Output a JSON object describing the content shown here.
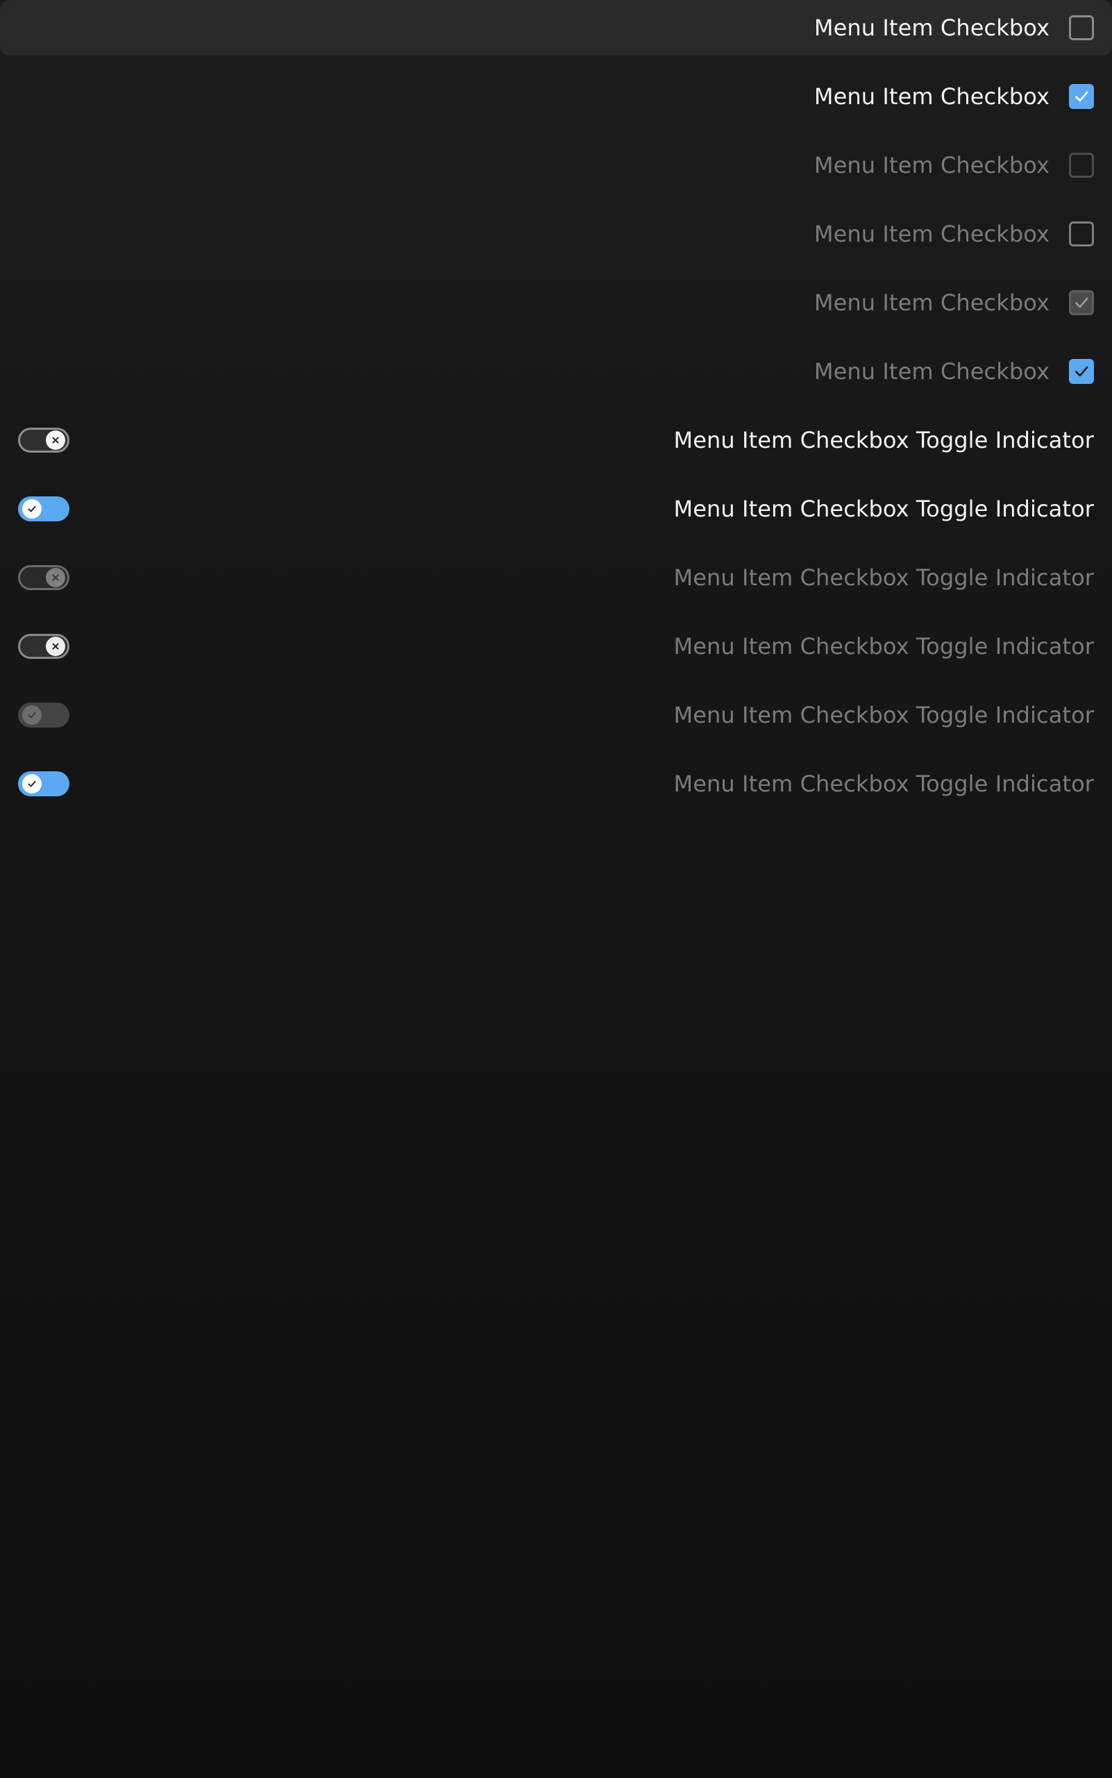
{
  "menu": {
    "checkbox_items": [
      {
        "label": "Menu Item Checkbox",
        "checked": false,
        "state": "highlighted"
      },
      {
        "label": "Menu Item Checkbox",
        "checked": true,
        "state": "normal"
      },
      {
        "label": "Menu Item Checkbox",
        "checked": false,
        "state": "disabled"
      },
      {
        "label": "Menu Item Checkbox",
        "checked": false,
        "state": "inactive"
      },
      {
        "label": "Menu Item Checkbox",
        "checked": true,
        "state": "disabled"
      },
      {
        "label": "Menu Item Checkbox",
        "checked": true,
        "state": "inactive"
      }
    ],
    "toggle_items": [
      {
        "label": "Menu Item Checkbox Toggle Indicator",
        "checked": false,
        "state": "normal"
      },
      {
        "label": "Menu Item Checkbox Toggle Indicator",
        "checked": true,
        "state": "normal"
      },
      {
        "label": "Menu Item Checkbox Toggle Indicator",
        "checked": false,
        "state": "disabled"
      },
      {
        "label": "Menu Item Checkbox Toggle Indicator",
        "checked": false,
        "state": "inactive"
      },
      {
        "label": "Menu Item Checkbox Toggle Indicator",
        "checked": true,
        "state": "disabled"
      },
      {
        "label": "Menu Item Checkbox Toggle Indicator",
        "checked": true,
        "state": "inactive"
      }
    ]
  },
  "colors": {
    "accent": "#5ba9f2",
    "text_primary": "#f3f3f3",
    "text_disabled": "#7b7b7b",
    "highlight_background": "#2a2a2b"
  },
  "icons": {
    "check": "check-icon",
    "cross": "x-icon"
  }
}
